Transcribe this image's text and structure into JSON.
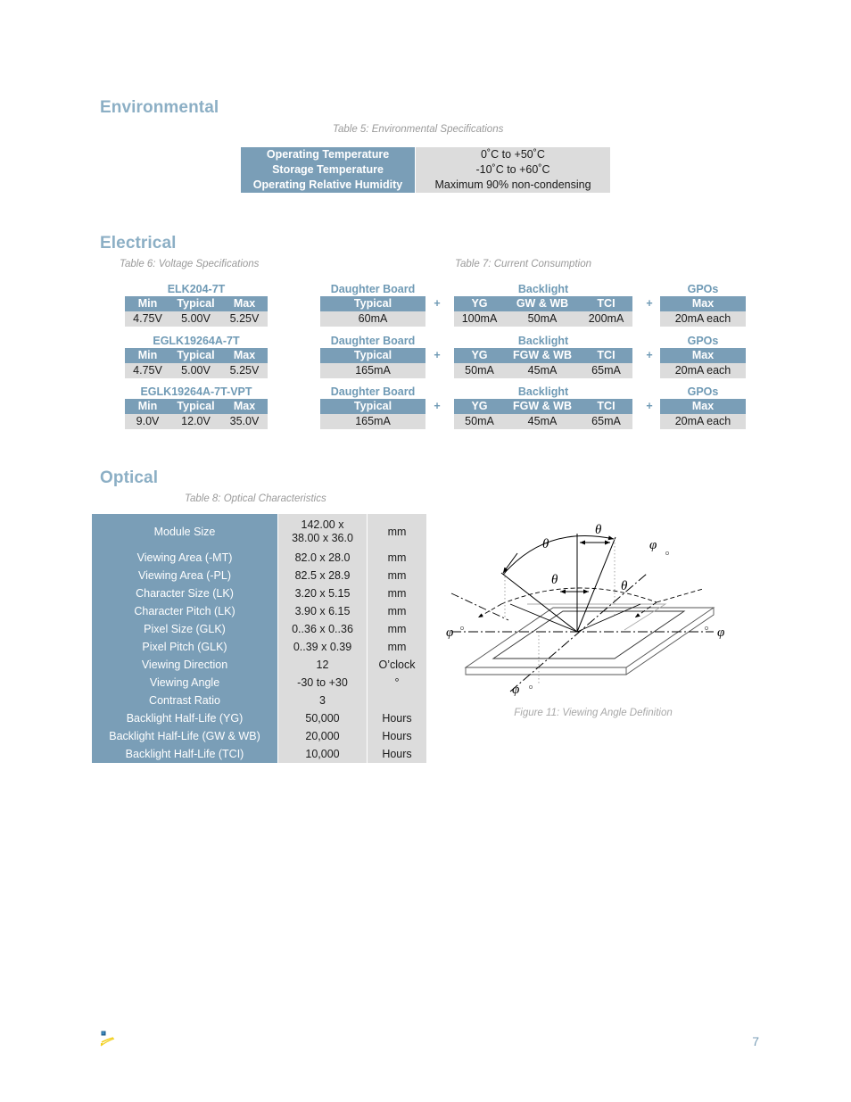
{
  "sections": {
    "environmental": {
      "heading": "Environmental",
      "caption": "Table 5: Environmental Specifications",
      "rows": [
        {
          "label": "Operating Temperature",
          "value": "0˚C to +50˚C"
        },
        {
          "label": "Storage Temperature",
          "value": "-10˚C to +60˚C"
        },
        {
          "label": "Operating Relative Humidity",
          "value": "Maximum 90% non-condensing"
        }
      ]
    },
    "electrical": {
      "heading": "Electrical",
      "caption_voltage": "Table 6: Voltage Specifications",
      "caption_current": "Table 7: Current Consumption",
      "voltage": {
        "columns": [
          "Min",
          "Typical",
          "Max"
        ],
        "blocks": [
          {
            "title": "ELK204-7T",
            "values": [
              "4.75V",
              "5.00V",
              "5.25V"
            ]
          },
          {
            "title": "EGLK19264A-7T",
            "values": [
              "4.75V",
              "5.00V",
              "5.25V"
            ]
          },
          {
            "title": "EGLK19264A-7T-VPT",
            "values": [
              "9.0V",
              "12.0V",
              "35.0V"
            ]
          }
        ]
      },
      "current": {
        "plus": "+",
        "daughter_board": {
          "group": "Daughter Board",
          "column": "Typical",
          "blocks": [
            "60mA",
            "165mA",
            "165mA"
          ]
        },
        "backlight": {
          "group": "Backlight",
          "blocks": [
            {
              "columns": [
                "YG",
                "GW & WB",
                "TCI"
              ],
              "values": [
                "100mA",
                "50mA",
                "200mA"
              ]
            },
            {
              "columns": [
                "YG",
                "FGW & WB",
                "TCI"
              ],
              "values": [
                "50mA",
                "45mA",
                "65mA"
              ]
            },
            {
              "columns": [
                "YG",
                "FGW & WB",
                "TCI"
              ],
              "values": [
                "50mA",
                "45mA",
                "65mA"
              ]
            }
          ]
        },
        "gpos": {
          "group": "GPOs",
          "column": "Max",
          "blocks": [
            "20mA each",
            "20mA each",
            "20mA each"
          ]
        }
      }
    },
    "optical": {
      "heading": "Optical",
      "caption": "Table 8: Optical Characteristics",
      "rows": [
        {
          "label": "Module Size",
          "value": "142.00 x",
          "value2": "38.00 x 36.0",
          "unit": "mm"
        },
        {
          "label": "Viewing Area (-MT)",
          "value": "82.0 x 28.0",
          "unit": "mm"
        },
        {
          "label": "Viewing Area (-PL)",
          "value": "82.5 x 28.9",
          "unit": "mm"
        },
        {
          "label": "Character Size (LK)",
          "value": "3.20 x 5.15",
          "unit": "mm"
        },
        {
          "label": "Character Pitch (LK)",
          "value": "3.90 x 6.15",
          "unit": "mm"
        },
        {
          "label": "Pixel Size (GLK)",
          "value": "0..36 x 0..36",
          "unit": "mm"
        },
        {
          "label": "Pixel Pitch (GLK)",
          "value": "0..39 x 0.39",
          "unit": "mm"
        },
        {
          "label": "Viewing Direction",
          "value": "12",
          "unit": "O’clock"
        },
        {
          "label": "Viewing Angle",
          "value": "-30 to +30",
          "unit": "°"
        },
        {
          "label": "Contrast Ratio",
          "value": "3",
          "unit": ""
        },
        {
          "label": "Backlight Half-Life (YG)",
          "value": "50,000",
          "unit": "Hours"
        },
        {
          "label": "Backlight Half-Life (GW & WB)",
          "value": "20,000",
          "unit": "Hours"
        },
        {
          "label": "Backlight Half-Life (TCI)",
          "value": "10,000",
          "unit": "Hours"
        }
      ],
      "figure": {
        "caption": "Figure 11: Viewing Angle Definition",
        "labels": {
          "theta": "θ",
          "phi": "φ"
        }
      }
    }
  },
  "footer": {
    "page_number": "7",
    "logo": "matrix-orbital-logo"
  },
  "colors": {
    "header_blue": "#7a9eb7",
    "heading_blue": "#8cafc5",
    "value_gray": "#dcdcdc",
    "caption_gray": "#9a9a9a"
  }
}
